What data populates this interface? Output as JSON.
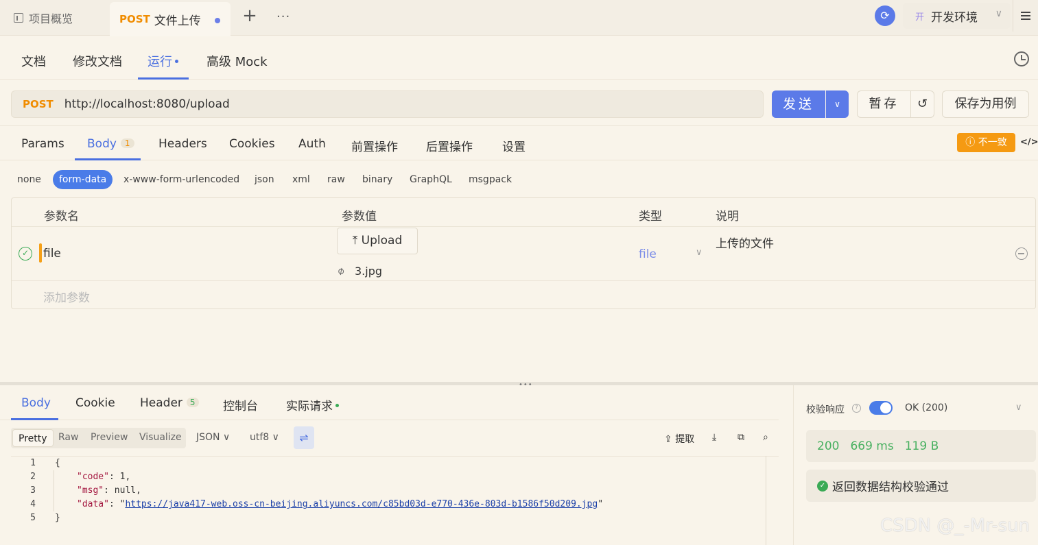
{
  "topbar": {
    "overview_tab": "项目概览",
    "active_tab_method": "POST",
    "active_tab_title": "文件上传",
    "plus": "+",
    "more": "···",
    "sync_icon": "⟳",
    "env_badge": "开",
    "env_name": "开发环境",
    "env_chevron": "∨"
  },
  "subnav": {
    "tabs": [
      "文档",
      "修改文档",
      "运行",
      "高级 Mock"
    ],
    "active_index": 2
  },
  "request": {
    "method": "POST",
    "url": "http://localhost:8080/upload",
    "send_label": "发送",
    "send_drop": "∨",
    "save_temp_label": "暂存",
    "reset_icon": "↺",
    "save_case_label": "保存为用例"
  },
  "req_tabs": {
    "params": "Params",
    "body": "Body",
    "body_count": "1",
    "headers": "Headers",
    "cookies": "Cookies",
    "auth": "Auth",
    "pre": "前置操作",
    "post": "后置操作",
    "settings": "设置",
    "inconsistent": "不一致",
    "code_icon": "</>"
  },
  "body_types": [
    "none",
    "form-data",
    "x-www-form-urlencoded",
    "json",
    "xml",
    "raw",
    "binary",
    "GraphQL",
    "msgpack"
  ],
  "params_table": {
    "headers": [
      "参数名",
      "参数值",
      "类型",
      "说明"
    ],
    "row": {
      "name": "file",
      "upload_label": "Upload",
      "filename": "3.jpg",
      "type": "file",
      "desc": "上传的文件"
    },
    "add_placeholder": "添加参数"
  },
  "response": {
    "tabs": {
      "body": "Body",
      "cookie": "Cookie",
      "header": "Header",
      "header_count": "5",
      "console": "控制台",
      "actual": "实际请求"
    },
    "views": [
      "Pretty",
      "Raw",
      "Preview",
      "Visualize"
    ],
    "format": "JSON",
    "encoding": "utf8",
    "tools": {
      "extract": "提取"
    },
    "code": {
      "line_numbers": [
        "1",
        "2",
        "3",
        "4",
        "5"
      ],
      "open_brace": "{",
      "code_key": "\"code\"",
      "code_val": "1,",
      "msg_key": "\"msg\"",
      "msg_val": "null,",
      "data_key": "\"data\"",
      "data_url": "https://java417-web.oss-cn-beijing.aliyuncs.com/c85bd03d-e770-436e-803d-b1586f50d209.jpg",
      "close_brace": "}"
    },
    "verify_label": "校验响应",
    "status_select": "OK (200)",
    "status_code": "200",
    "time": "669 ms",
    "size": "119 B",
    "verify_result": "返回数据结构校验通过"
  },
  "watermark": "CSDN @_-Mr-sun",
  "colors": {
    "accent": "#4a6fe0",
    "send": "#5b7ae8",
    "post_method": "#f08c00",
    "warning": "#f59a12",
    "success": "#3aaa55",
    "background": "#f9f4ea"
  }
}
